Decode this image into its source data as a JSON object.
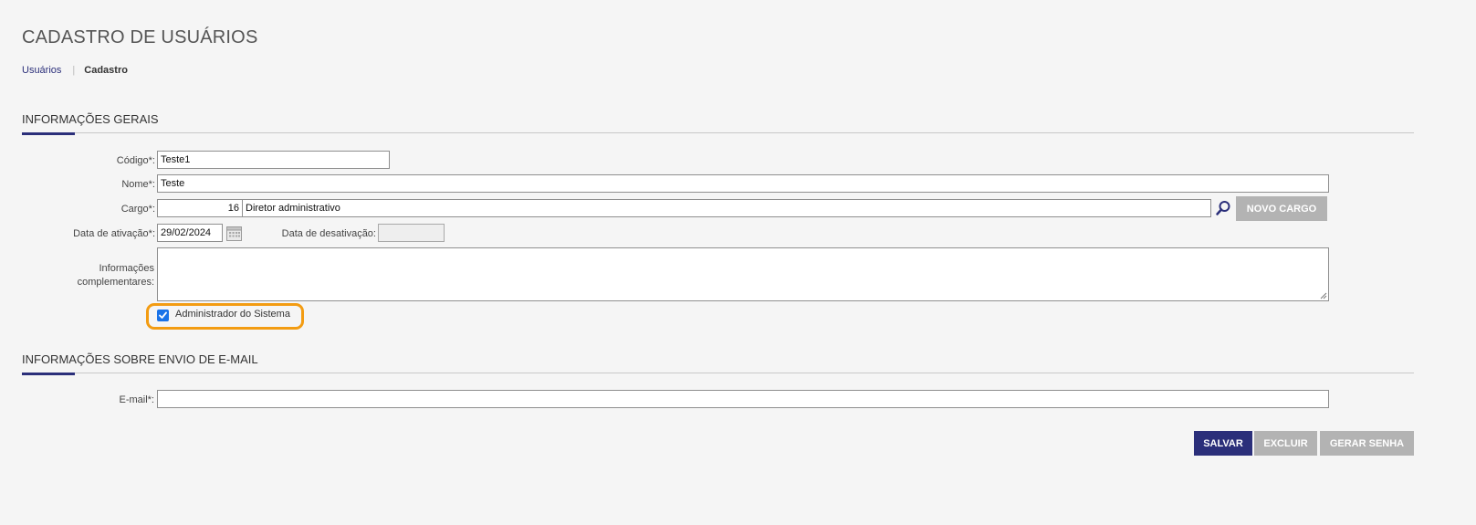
{
  "page": {
    "title": "CADASTRO DE USUÁRIOS",
    "breadcrumb": {
      "link": "Usuários",
      "current": "Cadastro"
    }
  },
  "sections": {
    "general": "INFORMAÇÕES GERAIS",
    "email": "INFORMAÇÕES SOBRE ENVIO DE E-MAIL"
  },
  "form": {
    "codigo": {
      "label": "Código*:",
      "value": "Teste1"
    },
    "nome": {
      "label": "Nome*:",
      "value": "Teste"
    },
    "cargo": {
      "label": "Cargo*:",
      "code": "16",
      "description": "Diretor administrativo",
      "new_button": "NOVO CARGO"
    },
    "data_ativacao": {
      "label": "Data de ativação*:",
      "value": "29/02/2024"
    },
    "data_desativacao": {
      "label": "Data de desativação:",
      "value": ""
    },
    "informacoes": {
      "label_line1": "Informações",
      "label_line2": "complementares:",
      "value": ""
    },
    "admin": {
      "label": "Administrador do Sistema",
      "checked": true
    },
    "email": {
      "label": "E-mail*:",
      "value": ""
    }
  },
  "actions": {
    "save": "SALVAR",
    "delete": "EXCLUIR",
    "generate_password": "GERAR SENHA"
  },
  "colors": {
    "primary": "#2b2f7a",
    "disabled_button": "#b3b3b3",
    "highlight": "#f39c12",
    "checkbox": "#1a73e8"
  },
  "icons": {
    "search": "search-icon",
    "calendar": "calendar-icon",
    "check": "check-icon"
  }
}
